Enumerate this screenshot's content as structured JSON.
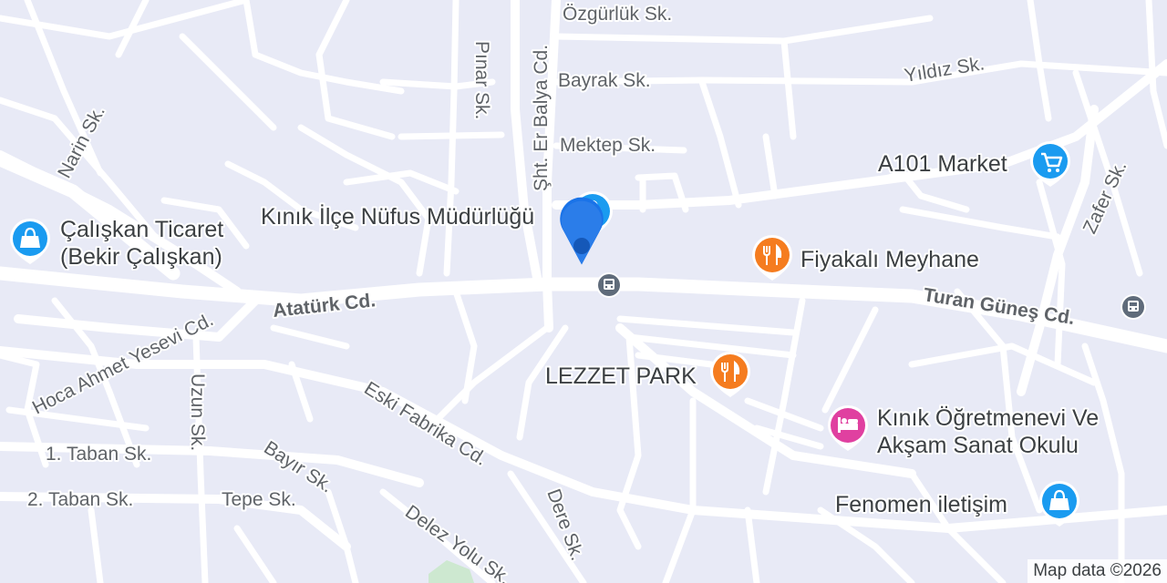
{
  "map": {
    "attribution": "Map data ©2026",
    "streets": {
      "ozgurluk": "Özgürlük Sk.",
      "bayrak": "Bayrak Sk.",
      "yildiz": "Yıldız Sk.",
      "pinar": "Pınar Sk.",
      "sht_er_balya": "Şht. Er Balya Cd.",
      "mektep": "Mektep Sk.",
      "narin": "Narin Sk.",
      "zafer": "Zafer Sk.",
      "ataturk": "Atatürk Cd.",
      "turan_gunes": "Turan Güneş Cd.",
      "hoca_ahmet": "Hoca Ahmet Yesevi Cd.",
      "uzun": "Uzun Sk.",
      "eski_fabrika": "Eski Fabrika Cd.",
      "taban1": "1. Taban Sk.",
      "taban2": "2. Taban Sk.",
      "bayir": "Bayır Sk.",
      "tepe": "Tepe Sk.",
      "dere": "Dere Sk.",
      "delez_yolu": "Delez Yolu Sk."
    },
    "pois": {
      "a101": {
        "label": "A101 Market",
        "icon": "shopping-cart-icon",
        "color": "#1a9bf0"
      },
      "nufus": {
        "label": "Kınık İlçe Nüfus Müdürlüğü",
        "icon": "shopping-bag-icon",
        "color": "#1a9bf0"
      },
      "caliskan": {
        "line1": "Çalışkan Ticaret",
        "line2": "(Bekir Çalışkan)",
        "icon": "shopping-bag-icon",
        "color": "#1a9bf0"
      },
      "fiyakali": {
        "label": "Fiyakalı Meyhane",
        "icon": "restaurant-icon",
        "color": "#f57c1f"
      },
      "lezzet": {
        "label": "LEZZET PARK",
        "icon": "restaurant-icon",
        "color": "#f57c1f"
      },
      "ogretmenevi": {
        "line1": "Kınık Öğretmenevi Ve",
        "line2": "Akşam Sanat Okulu",
        "icon": "hotel-bed-icon",
        "color": "#e040a0"
      },
      "fenomen": {
        "label": "Fenomen iletişim",
        "icon": "shopping-bag-icon",
        "color": "#1a9bf0"
      }
    },
    "marker_color": "#1a73e8",
    "bus_icon": "bus-stop-icon"
  }
}
